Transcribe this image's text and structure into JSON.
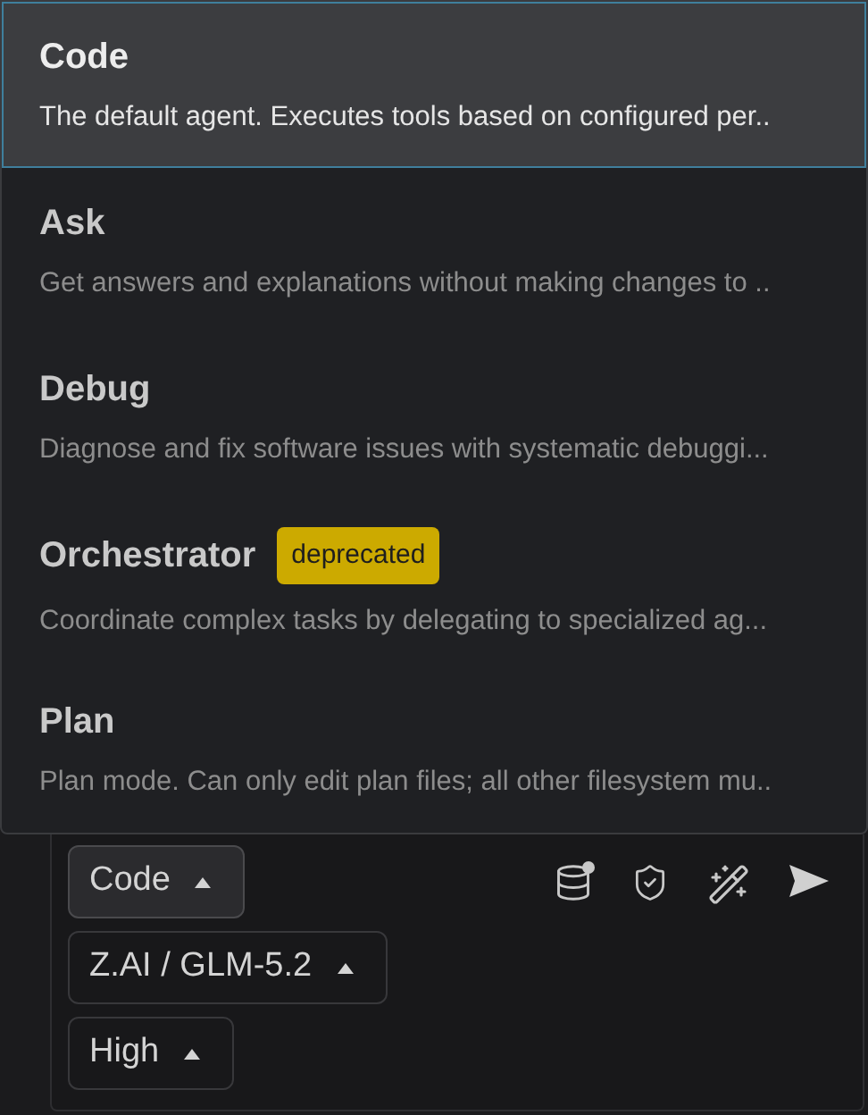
{
  "mode_menu": {
    "items": [
      {
        "name": "Code",
        "description": "The default agent. Executes tools based on configured per..",
        "selected": true
      },
      {
        "name": "Ask",
        "description": "Get answers and explanations without making changes to ..",
        "selected": false
      },
      {
        "name": "Debug",
        "description": "Diagnose and fix software issues with systematic debuggi...",
        "selected": false
      },
      {
        "name": "Orchestrator",
        "badge": "deprecated",
        "description": "Coordinate complex tasks by delegating to specialized ag...",
        "selected": false
      },
      {
        "name": "Plan",
        "description": "Plan mode. Can only edit plan files; all other filesystem mu..",
        "selected": false
      }
    ]
  },
  "composer": {
    "selectors": [
      {
        "label": "Code",
        "kind": "mode"
      },
      {
        "label": "Z.AI / GLM-5.2",
        "kind": "model"
      },
      {
        "label": "High",
        "kind": "effort"
      }
    ],
    "actions": [
      {
        "kind": "context"
      },
      {
        "kind": "permissions"
      },
      {
        "kind": "enhance"
      },
      {
        "kind": "send"
      }
    ]
  }
}
